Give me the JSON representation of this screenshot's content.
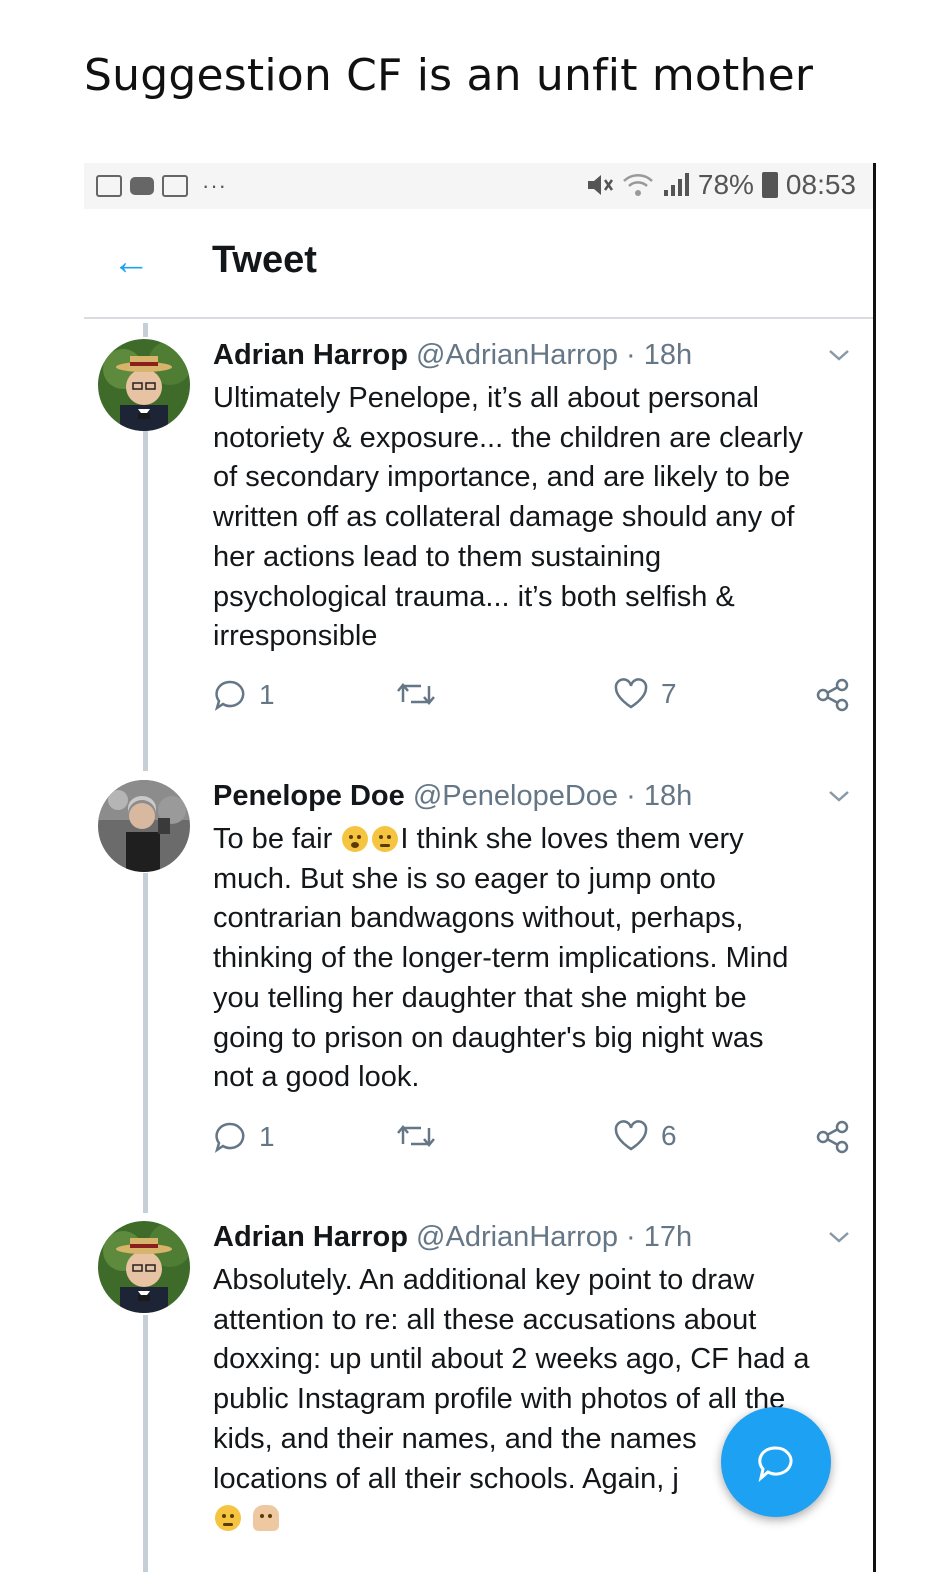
{
  "slide": {
    "title": "Suggestion CF is an unfit mother"
  },
  "status_bar": {
    "left_icons": [
      "gallery-icon",
      "video-icon",
      "image-icon"
    ],
    "dots": "···",
    "right_icons": [
      "mute-icon",
      "wifi-icon",
      "signal-icon"
    ],
    "battery": "78%",
    "time": "08:53"
  },
  "header": {
    "back_icon": "back-arrow-icon",
    "title": "Tweet"
  },
  "tweets": [
    {
      "name": "Adrian Harrop",
      "handle": "@AdrianHarrop",
      "dot": "·",
      "time": "18h",
      "lines": [
        "Ultimately Penelope, it’s all about personal",
        "notoriety & exposure... the children are clearly",
        "of secondary importance, and are likely to be",
        "written off as collateral damage should any of",
        "her actions lead to them sustaining",
        "psychological trauma... it’s both selfish &",
        "irresponsible"
      ],
      "replies": "1",
      "likes": "7"
    },
    {
      "name": "Penelope Doe",
      "handle": "@PenelopeDoe",
      "dot": "·",
      "time": "18h",
      "line1_before": "To be fair",
      "line1_after": "I think she loves them very",
      "lines": [
        "much. But she is so eager to jump onto",
        "contrarian bandwagons without, perhaps,",
        "thinking of the longer-term implications. Mind",
        "you telling her daughter that she might be",
        "going to prison on daughter's big night was",
        "not a good look."
      ],
      "replies": "1",
      "likes": "6"
    },
    {
      "name": "Adrian Harrop",
      "handle": "@AdrianHarrop",
      "dot": "·",
      "time": "17h",
      "lines": [
        "Absolutely. An additional key point to draw",
        "attention to re: all these accusations about",
        "doxxing: up until about 2 weeks ago, CF had a",
        "public Instagram profile with photos of all the",
        "kids, and their names, and the names",
        "locations of all their schools. Again, j"
      ]
    }
  ],
  "colors": {
    "accent": "#1da1f2",
    "text": "#14171a",
    "muted": "#657786",
    "thread": "#c6cfd6"
  }
}
